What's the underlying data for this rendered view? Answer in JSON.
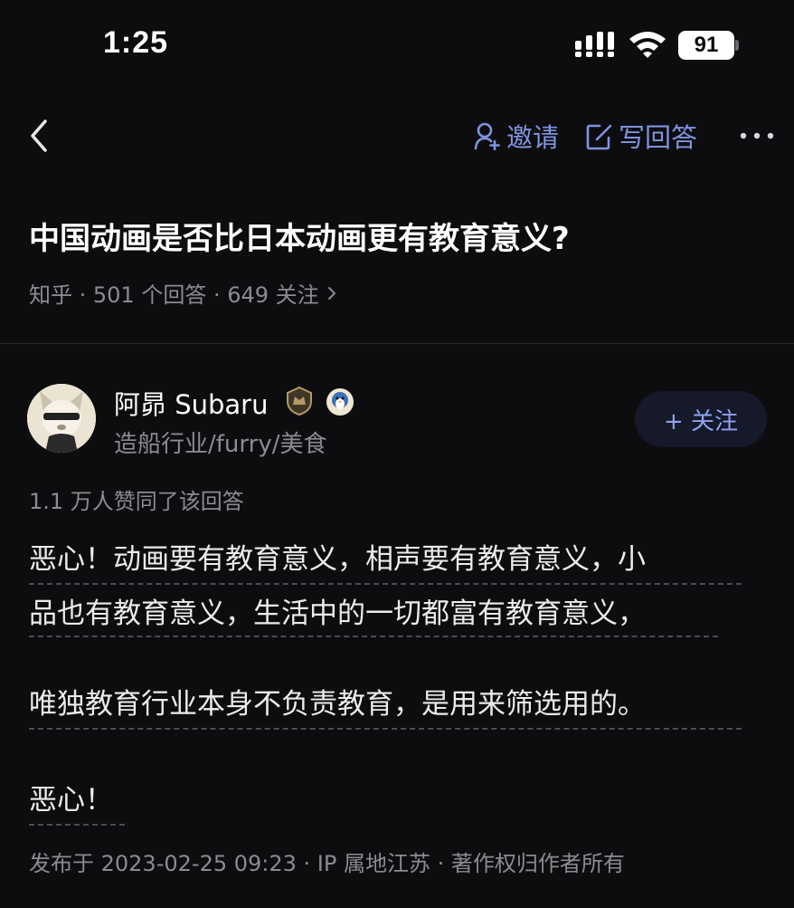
{
  "status_bar": {
    "time": "1:25",
    "battery_level": "91"
  },
  "nav": {
    "back_icon": "chevron-left-icon",
    "invite_label": "邀请",
    "invite_icon": "person-plus-icon",
    "write_answer_label": "写回答",
    "write_answer_icon": "pencil-square-icon",
    "more_icon": "more-horizontal-icon",
    "accent_color": "#7f93df"
  },
  "question": {
    "title": "中国动画是否比日本动画更有教育意义?",
    "meta": "知乎 · 501 个回答 · 649 关注"
  },
  "author": {
    "name": "阿昴 Subaru",
    "bio": "造船行业/furry/美食",
    "follow_label": "+ 关注",
    "badges": [
      "shield-badge-icon",
      "penguin-badge-icon"
    ]
  },
  "answer": {
    "upvote_summary": "1.1 万人赞同了该回答",
    "paragraphs": [
      "恶心！动画要有教育意义，相声要有教育意义，小",
      "品也有教育意义，生活中的一切都富有教育意义，",
      "唯独教育行业本身不负责教育，是用来筛选用的。",
      "恶心！"
    ],
    "footer": "发布于 2023-02-25 09:23 · IP 属地江苏 · 著作权归作者所有"
  }
}
